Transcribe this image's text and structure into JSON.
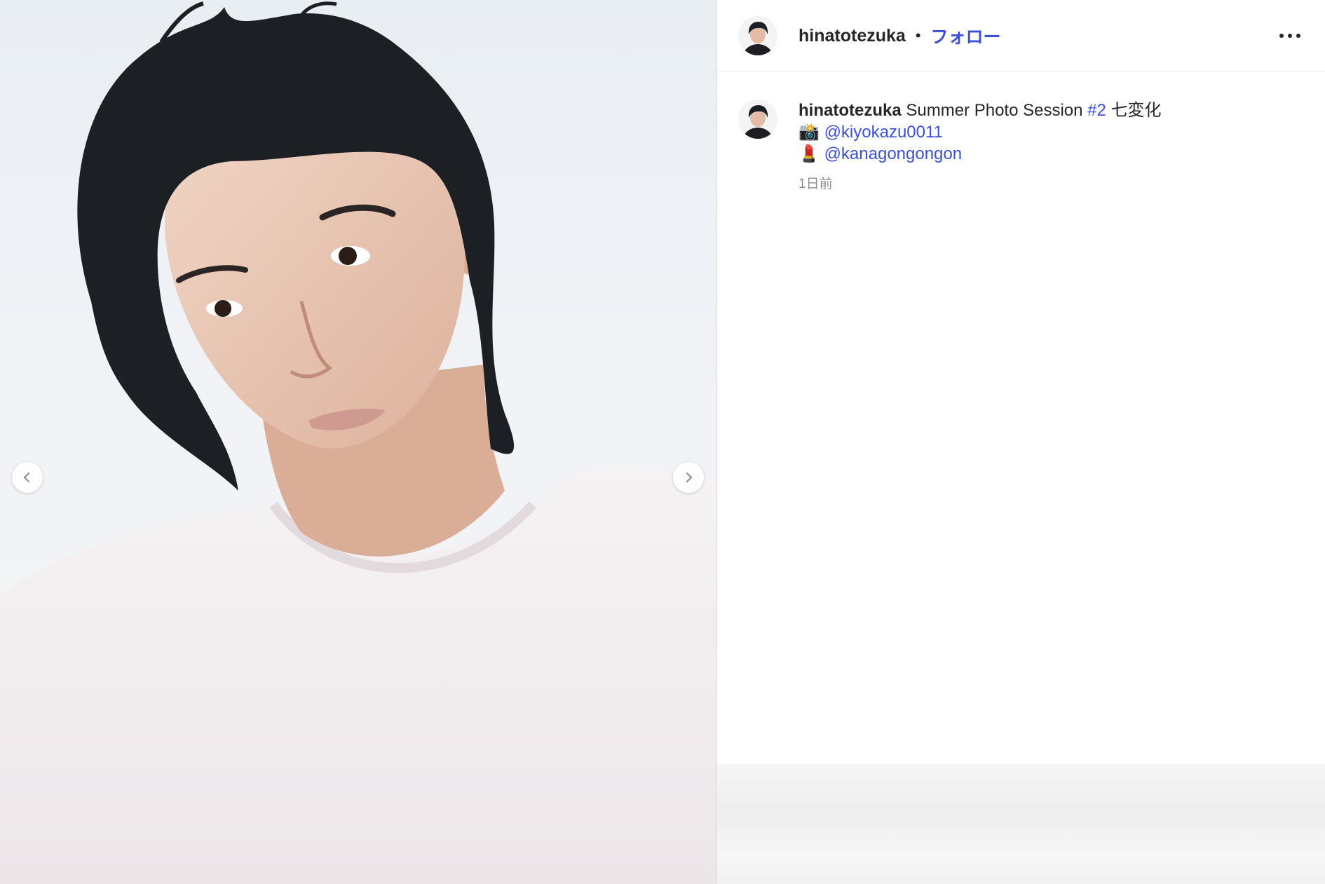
{
  "post": {
    "author": {
      "username": "hinatotezuka",
      "follow_label": "フォロー",
      "separator": "•"
    },
    "caption": {
      "username": "hinatotezuka",
      "text": "Summer Photo Session",
      "hashtag": "#2",
      "suffix": "七変化",
      "camera_emoji": "📸",
      "photographer": "@kiyokazu0011",
      "lipstick_emoji": "💄",
      "makeup_artist": "@kanagongongon",
      "timestamp": "1日前"
    },
    "media": {
      "carousel": {
        "prev_icon": "chevron-left-icon",
        "next_icon": "chevron-right-icon"
      }
    },
    "icons": {
      "more": "more-horizontal-icon"
    },
    "colors": {
      "link": "#3b4fd8",
      "text": "#262626",
      "muted": "#8e8e8e",
      "border": "#dbdbdb"
    }
  }
}
